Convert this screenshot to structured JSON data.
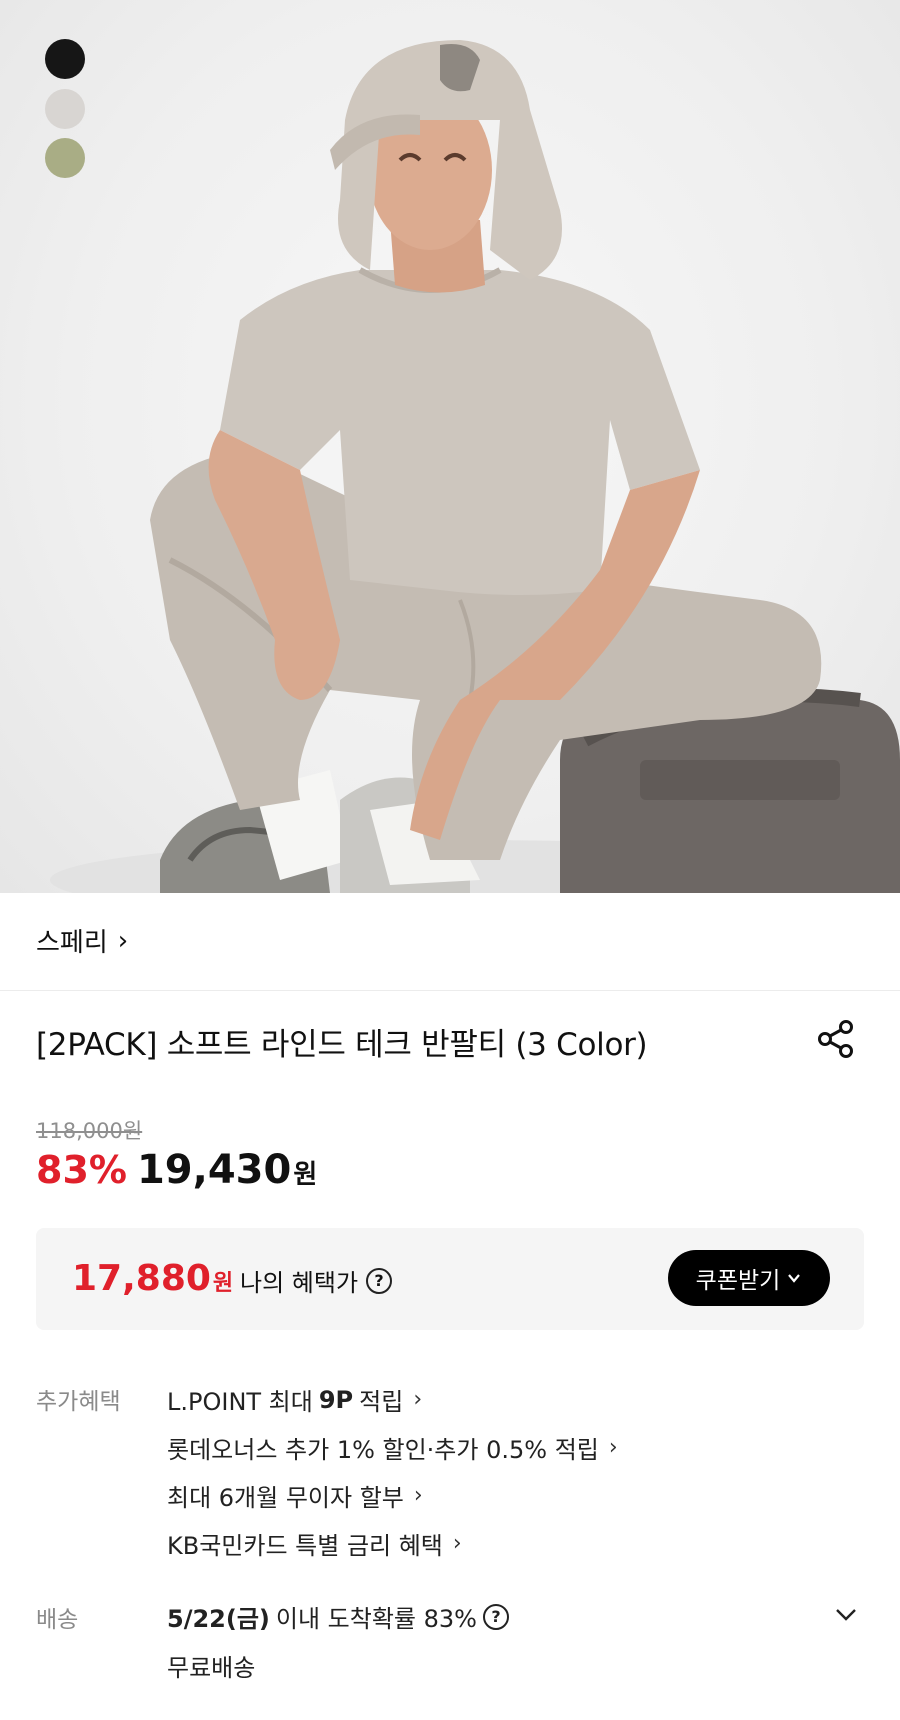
{
  "colors": {
    "accent_red": "#e0202b",
    "button_black": "#000000",
    "box_gray": "#f5f5f5",
    "label_gray": "#8a8a8a"
  },
  "swatches": [
    {
      "name": "black",
      "color": "#161616"
    },
    {
      "name": "light-gray",
      "color": "#d8d5d2"
    },
    {
      "name": "sage",
      "color": "#a9ad85"
    }
  ],
  "brand": {
    "name": "스페리",
    "arrow": "›"
  },
  "product": {
    "title": "[2PACK] 소프트 라인드 테크 반팔티 (3 Color)",
    "share_icon": "share-icon"
  },
  "price": {
    "original": "118,000원",
    "discount": "83%",
    "sale": "19,430",
    "won": "원"
  },
  "my_benefit": {
    "price": "17,880",
    "won": "원",
    "label": "나의 혜택가",
    "help": "?",
    "coupon_button": "쿠폰받기"
  },
  "extra_benefits": {
    "label": "추가혜택",
    "items": [
      {
        "pre": "L.POINT 최대 ",
        "bold": "9P",
        "post": " 적립"
      },
      {
        "pre": "롯데오너스 추가 1% 할인·추가 0.5% 적립",
        "bold": "",
        "post": ""
      },
      {
        "pre": "최대 6개월 무이자 할부",
        "bold": "",
        "post": ""
      },
      {
        "pre": "KB국민카드 특별 금리 혜택",
        "bold": "",
        "post": ""
      }
    ],
    "arrow": "›"
  },
  "shipping": {
    "label": "배송",
    "date": "5/22(금)",
    "text": " 이내 도착확률 83%",
    "help": "?",
    "free": "무료배송"
  }
}
